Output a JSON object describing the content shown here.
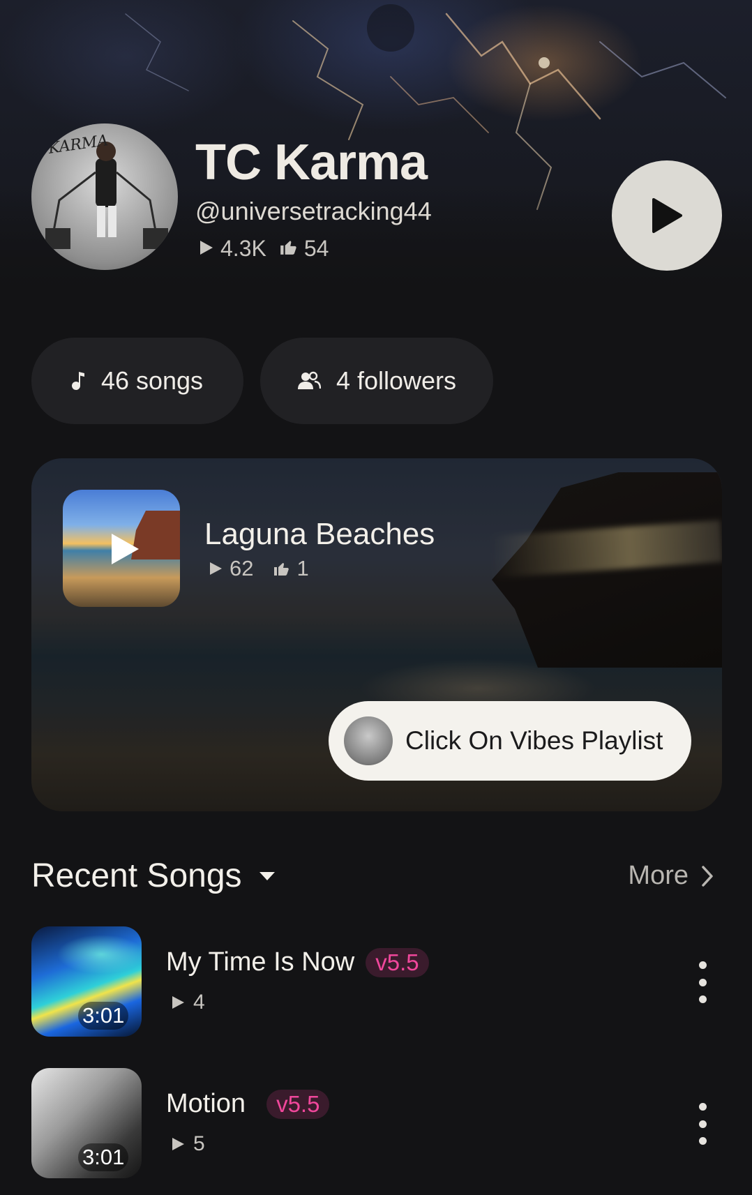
{
  "artist": {
    "name": "TC Karma",
    "handle": "@universetracking44",
    "plays": "4.3K",
    "likes": "54",
    "avatar_text": "KARMA"
  },
  "chips": {
    "songs": "46 songs",
    "followers": "4 followers"
  },
  "featured": {
    "title": "Laguna Beaches",
    "plays": "62",
    "likes": "1",
    "cta_label": "Click On Vibes Playlist"
  },
  "recent": {
    "title": "Recent Songs",
    "more_label": "More",
    "songs": [
      {
        "title": "My Time Is Now",
        "version": "v5.5",
        "plays": "4",
        "duration": "3:01"
      },
      {
        "title": "Motion",
        "version": "v5.5",
        "plays": "5",
        "duration": "3:01"
      }
    ]
  },
  "colors": {
    "background": "#131315",
    "accent_badge": "#f0479b",
    "play_button": "#dcdad4"
  },
  "icons": [
    "play-icon",
    "thumbs-up-icon",
    "music-note-icon",
    "users-icon",
    "caret-down-icon",
    "chevron-right-icon",
    "kebab-menu-icon"
  ]
}
